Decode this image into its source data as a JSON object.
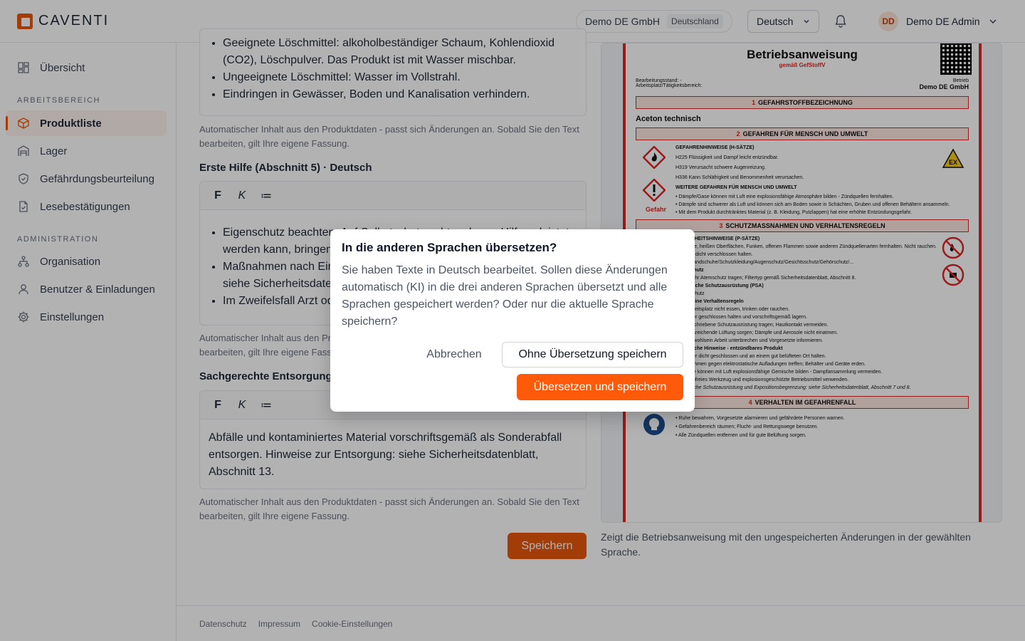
{
  "header": {
    "logo_text": "CAVENTI",
    "org_name": "Demo DE GmbH",
    "org_country": "Deutschland",
    "language": "Deutsch",
    "user_initials": "DD",
    "user_name": "Demo DE Admin"
  },
  "sidebar": {
    "overview": "Übersicht",
    "section_work": "ARBEITSBEREICH",
    "items_work": [
      "Produktliste",
      "Lager",
      "Gefährdungsbeurteilung",
      "Lesebestätigungen"
    ],
    "section_admin": "ADMINISTRATION",
    "items_admin": [
      "Organisation",
      "Benutzer & Einladungen",
      "Einstellungen"
    ]
  },
  "editor": {
    "toolbar": {
      "bold": "F",
      "italic": "K",
      "list": "≔"
    },
    "firefight_items": [
      "Geeignete Löschmittel: alkoholbeständiger Schaum, Kohlendioxid (CO2), Löschpulver. Das Produkt ist mit Wasser mischbar.",
      "Ungeeignete Löschmittel: Wasser im Vollstrahl.",
      "Eindringen in Gewässer, Boden und Kanalisation verhindern."
    ],
    "hint": "Automatischer Inhalt aus den Produktdaten - passt sich Änderungen an. Sobald Sie den Text bearbeiten, gilt Ihre eigene Fassung.",
    "first_aid_title": "Erste Hilfe (Abschnitt 5) · Deutsch",
    "first_aid_items": [
      "Eigenschutz beachten. Auf Selbstschutz achten, bevor Hilfe geleistet werden kann, bringen.",
      "Maßnahmen nach Einatmen, Haut-, Augenkontakt und Verschlucken: siehe Sicherheitsdatenblatt, Abschnitt 4.",
      "Im Zweifelsfall Arzt oder Notruf hinzuziehen."
    ],
    "disposal_title": "Sachgerechte Entsorgung",
    "disposal_text": "Abfälle und kontaminiertes Material vorschriftsgemäß als Sonderabfall entsorgen. Hinweise zur Entsorgung: siehe Sicherheitsdatenblatt, Abschnitt 13.",
    "save_label": "Speichern"
  },
  "preview": {
    "doc_title": "Betriebsanweisung",
    "doc_subtitle": "gemäß GefStoffV",
    "meta_left_1": "Bearbeitungsstand: -",
    "meta_left_2": "Arbeitsplatz/Tätigkeitsbereich:",
    "meta_right_1": "Betrieb",
    "meta_right_2": "Demo DE GmbH",
    "s1": "GEFAHRSTOFFBEZEICHNUNG",
    "product": "Aceton technisch",
    "s2": "GEFAHREN FÜR MENSCH UND UMWELT",
    "h_title": "GEFAHRENHINWEISE (H-SÄTZE)",
    "h_lines": [
      "H225   Flüssigkeit und Dampf leicht entzündbar.",
      "H319   Verursacht schwere Augenreizung.",
      "H336   Kann Schläfrigkeit und Benommenheit verursachen."
    ],
    "w_title": "WEITERE GEFAHREN FÜR MENSCH UND UMWELT",
    "w_lines": [
      "• Dämpfe/Gase können mit Luft eine explosionsfähige Atmosphäre bilden - Zündquellen fernhalten.",
      "• Dämpfe sind schwerer als Luft und können sich am Boden sowie in Schächten, Gruben und offenen Behältern ansammeln.",
      "• Mit dem Produkt durchtränktes Material (z. B. Kleidung, Putzlappen) hat eine erhöhte Entzündungsgefahr."
    ],
    "signal": "Gefahr",
    "s3": "SCHUTZMASSNAHMEN UND VERHALTENSREGELN",
    "p_title": "SICHERHEITSHINWEISE (P-SÄTZE)",
    "p_lines": [
      "Von Hitze, heißen Oberflächen, Funken, offenen Flammen sowie anderen Zündquellenarten fernhalten. Nicht rauchen.",
      "Behälter dicht verschlossen halten.",
      "Schutzhandschuhe/Schutzkleidung/Augenschutz/Gesichtsschutz/Gehörschutz/...",
      "Atemschutz",
      "Bei Gefahr Atemschutz tragen; Filtertyp gemäß Sicherheitsdatenblatt, Abschnitt 8.",
      "Persönliche Schutzausrüstung (PSA)",
      "Augenschutz",
      "Allgemeine Verhaltensregeln",
      "• Am Arbeitsplatz nicht essen, trinken oder rauchen.",
      "• Behälter geschlossen halten und vorschriftsgemäß lagern.",
      "• Vorgeschriebene Schutzausrüstung tragen; Hautkontakt vermeiden.",
      "• Für ausreichende Lüftung sorgen; Dämpfe und Aerosole nicht einatmen.",
      "• Bei Unwohlsein Arbeit unterbrechen und Vorgesetzte informieren."
    ],
    "z_title": "Zusätzliche Hinweise - entzündbares Produkt",
    "z_lines": [
      "• Behälter dicht geschlossen und an einem gut belüfteten Ort halten.",
      "• Maßnahmen gegen elektrostatische Aufladungen treffen; Behälter und Geräte erden.",
      "• Dämpfe können mit Luft explosionsfähige Gemische bilden - Dampfansammlung vermeiden.",
      "• Funkenfreies Werkzeug und explosionsgeschützte Betriebsmittel verwenden.",
      "Persönliche Schutzausrüstung und Expositionsbegrenzung: siehe Sicherheitsdatenblatt, Abschnitt 7 und 8."
    ],
    "s4": "VERHALTEN IM GEFAHRENFALL",
    "e_lines": [
      "• Ruhe bewahren, Vorgesetzte alarmieren und gefährdete Personen warnen.",
      "• Gefahrenbereich räumen; Flucht- und Rettungswege benutzen.",
      "• Alle Zündquellen entfernen und für gute Belüftung sorgen."
    ],
    "hint": "Zeigt die Betriebsanweisung mit den ungespeicherten Änderungen in der gewählten Sprache."
  },
  "footer": {
    "links": [
      "Datenschutz",
      "Impressum",
      "Cookie-Einstellungen"
    ]
  },
  "modal": {
    "title": "In die anderen Sprachen übersetzen?",
    "text": "Sie haben Texte in Deutsch bearbeitet. Sollen diese Änderungen automatisch (KI) in die drei anderen Sprachen übersetzt und alle Sprachen gespeichert werden? Oder nur die aktuelle Sprache speichern?",
    "cancel": "Abbrechen",
    "save_without": "Ohne Übersetzung speichern",
    "translate_save": "Übersetzen und speichern"
  },
  "colors": {
    "accent": "#ea580c",
    "primary_button": "#ff5a0a",
    "danger": "#dc2626"
  }
}
